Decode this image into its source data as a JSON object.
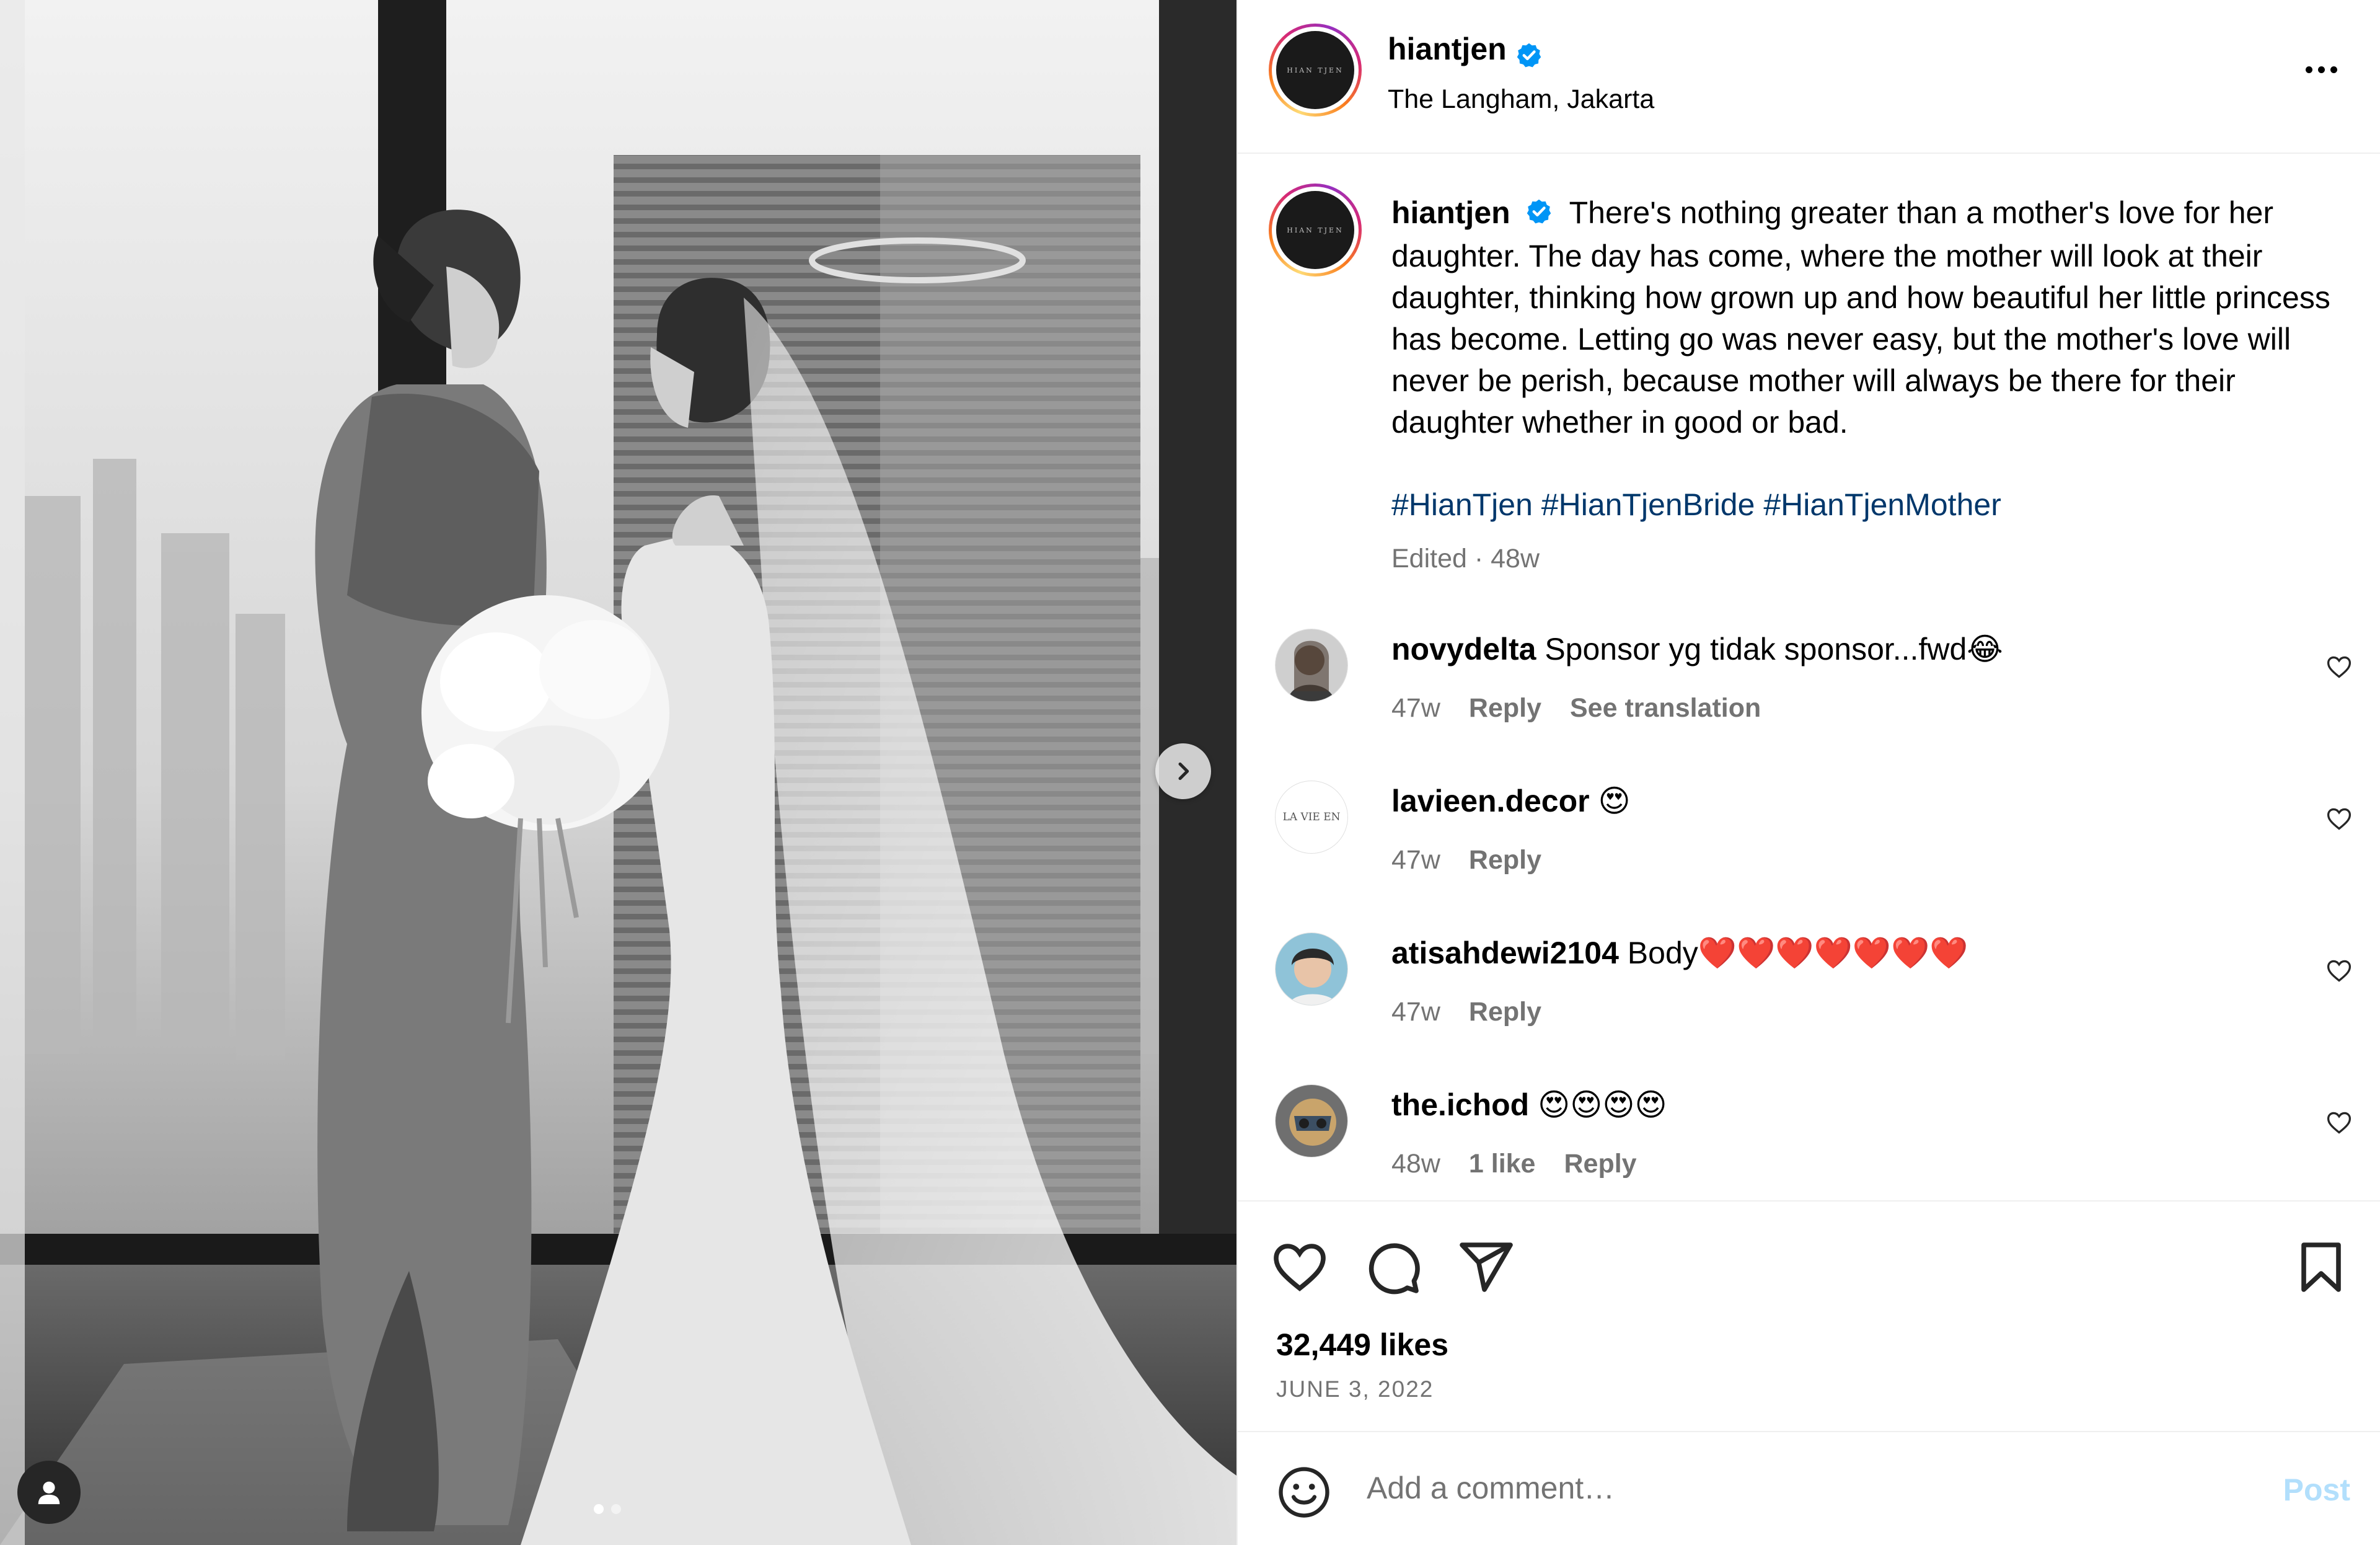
{
  "post": {
    "username": "hiantjen",
    "location": "The Langham, Jakarta",
    "avatar_logo_text": "HIAN TJEN",
    "caption": "There's nothing greater than a mother's love for her daughter. The day has come, where the mother will look at their daughter, thinking how grown up and how beautiful her little princess has become. Letting go was never easy, but the mother's love will never be perish, because mother will always be there for their daughter whether in good or bad.",
    "hashtags": "#HianTjen #HianTjenBride #HianTjenMother",
    "edited_meta": "Edited · 48w",
    "likes": "32,449 likes",
    "date": "JUNE 3, 2022",
    "carousel_index": 1,
    "carousel_count": 2
  },
  "comments": [
    {
      "username": "novydelta",
      "text": "Sponsor yg tidak sponsor...fwd😂",
      "time": "47w",
      "likes": "",
      "actions": [
        "Reply",
        "See translation"
      ]
    },
    {
      "username": "lavieen.decor",
      "text": "😍",
      "time": "47w",
      "likes": "",
      "avatar_text": "LA VIE EN",
      "actions": [
        "Reply"
      ]
    },
    {
      "username": "atisahdewi2104",
      "text": "Body❤️❤️❤️❤️❤️❤️❤️",
      "time": "47w",
      "likes": "",
      "actions": [
        "Reply"
      ]
    },
    {
      "username": "the.ichod",
      "text": "😍😍😍😍",
      "time": "48w",
      "likes": "1 like",
      "actions": [
        "Reply"
      ]
    }
  ],
  "add_comment": {
    "placeholder": "Add a comment…",
    "post_label": "Post"
  },
  "colors": {
    "verified": "#0095f6",
    "hashtag": "#00376b",
    "muted": "#737373",
    "post_disabled": "#b2dffc"
  },
  "icons": {
    "next": "chevron-right-icon",
    "tag": "user-icon",
    "more": "more-horizontal-icon",
    "like": "heart-outline-icon",
    "comment": "comment-icon",
    "share": "paper-plane-icon",
    "save": "bookmark-icon",
    "emoji": "smiley-icon"
  }
}
